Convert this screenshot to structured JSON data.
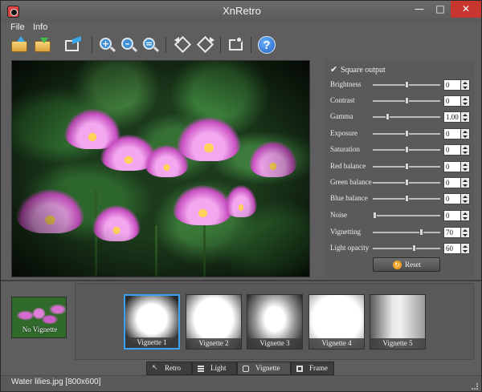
{
  "window": {
    "title": "XnRetro"
  },
  "menu": {
    "items": [
      "File",
      "Info"
    ]
  },
  "toolbar": {
    "icons": [
      "open-icon",
      "save-icon",
      "export-icon",
      "zoom-in-icon",
      "zoom-out-icon",
      "zoom-fit-icon",
      "rotate-left-icon",
      "rotate-right-icon",
      "settings-icon",
      "help-icon"
    ],
    "help_glyph": "?"
  },
  "adjustments": {
    "square_output": {
      "label": "Square output",
      "checked": true
    },
    "items": [
      {
        "label": "Brightness",
        "value": "0"
      },
      {
        "label": "Contrast",
        "value": "0"
      },
      {
        "label": "Gamma",
        "value": "1.00"
      },
      {
        "label": "Exposure",
        "value": "0"
      },
      {
        "label": "Saturation",
        "value": "0"
      },
      {
        "label": "Red balance",
        "value": "0"
      },
      {
        "label": "Green balance",
        "value": "0"
      },
      {
        "label": "Blue balance",
        "value": "0"
      },
      {
        "label": "Noise",
        "value": "0"
      },
      {
        "label": "Vignetting",
        "value": "70"
      },
      {
        "label": "Light opacity",
        "value": "60"
      }
    ],
    "reset_label": "Reset"
  },
  "presets": {
    "original_label": "No Vignette",
    "items": [
      {
        "label": "Vignette 1",
        "selected": true
      },
      {
        "label": "Vignette 2",
        "selected": false
      },
      {
        "label": "Vignette 3",
        "selected": false
      },
      {
        "label": "Vignette 4",
        "selected": false
      },
      {
        "label": "Vignette 5",
        "selected": false
      }
    ]
  },
  "tabs": [
    {
      "label": "Retro",
      "active": false
    },
    {
      "label": "Light",
      "active": false
    },
    {
      "label": "Vignette",
      "active": true
    },
    {
      "label": "Frame",
      "active": false
    }
  ],
  "status": {
    "text": "Water lilies.jpg [800x600]"
  },
  "colors": {
    "accent": "#3ea0f2",
    "close": "#c7372f",
    "background": "#5e5e5e"
  }
}
